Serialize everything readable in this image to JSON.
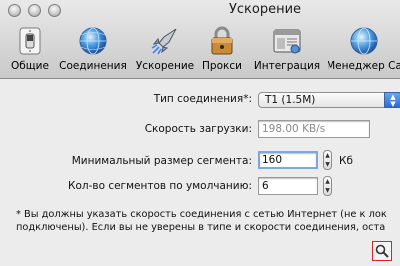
{
  "window": {
    "title": "Ускорение"
  },
  "toolbar": {
    "items": [
      {
        "label": "Общие",
        "icon": "light-switch-icon"
      },
      {
        "label": "Соединения",
        "icon": "globe-icon"
      },
      {
        "label": "Ускорение",
        "icon": "rocket-icon"
      },
      {
        "label": "Прокси",
        "icon": "padlock-icon"
      },
      {
        "label": "Интеграция",
        "icon": "app-window-icon"
      },
      {
        "label": "Менеджер Са",
        "icon": "globe-site-icon"
      }
    ]
  },
  "form": {
    "connection_type": {
      "label": "Тип соединения*:",
      "value": "T1 (1.5M)"
    },
    "download_speed": {
      "label": "Скорость загрузки:",
      "value": "198.00 KB/s"
    },
    "min_segment": {
      "label": "Минимальный размер сегмента:",
      "value": "160",
      "unit": "Кб"
    },
    "segments_default": {
      "label": "Кол-во сегментов по умолчанию:",
      "value": "6"
    }
  },
  "note": {
    "line1": "* Вы должны указать скорость соединения с сетью Интернет (не к лок",
    "line2": "подключены). Если вы не уверены в типе и скорости соединения, оста"
  },
  "colors": {
    "select_accent": "#2c6ad4",
    "focus_ring": "#7ea6e0",
    "highlight_border": "#d02828"
  }
}
